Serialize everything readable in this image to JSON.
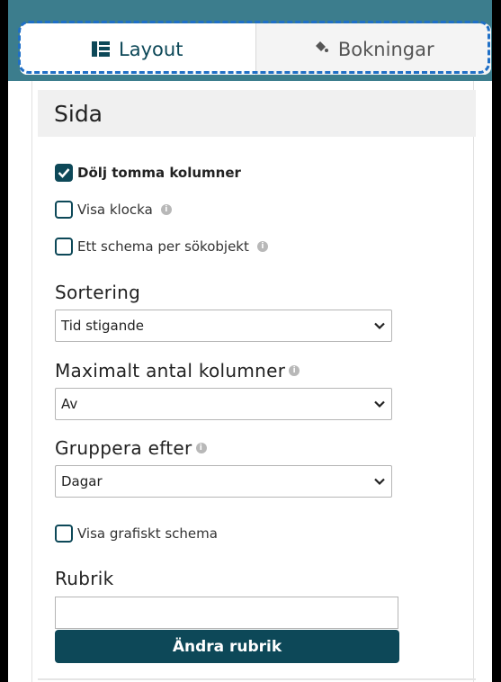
{
  "tabs": [
    {
      "label": "Layout",
      "icon": "layout-icon",
      "active": true
    },
    {
      "label": "Bokningar",
      "icon": "paint-bucket-icon",
      "active": false
    }
  ],
  "section": {
    "title": "Sida"
  },
  "checkboxes": {
    "hide_empty": {
      "label": "Dölj tomma kolumner",
      "checked": true
    },
    "show_clock": {
      "label": "Visa klocka",
      "checked": false
    },
    "one_schedule": {
      "label": "Ett schema per sökobjekt",
      "checked": false
    },
    "graphic_schedule": {
      "label": "Visa grafiskt schema",
      "checked": false
    }
  },
  "sorting": {
    "label": "Sortering",
    "value": "Tid stigande"
  },
  "max_columns": {
    "label": "Maximalt antal kolumner",
    "value": "Av"
  },
  "group_by": {
    "label": "Gruppera efter",
    "value": "Dagar"
  },
  "heading": {
    "label": "Rubrik",
    "value": "",
    "button_label": "Ändra rubrik"
  },
  "colors": {
    "accent": "#0d4858",
    "tab_outline": "#1f6fc6",
    "header_bg": "#3c7d8d"
  }
}
